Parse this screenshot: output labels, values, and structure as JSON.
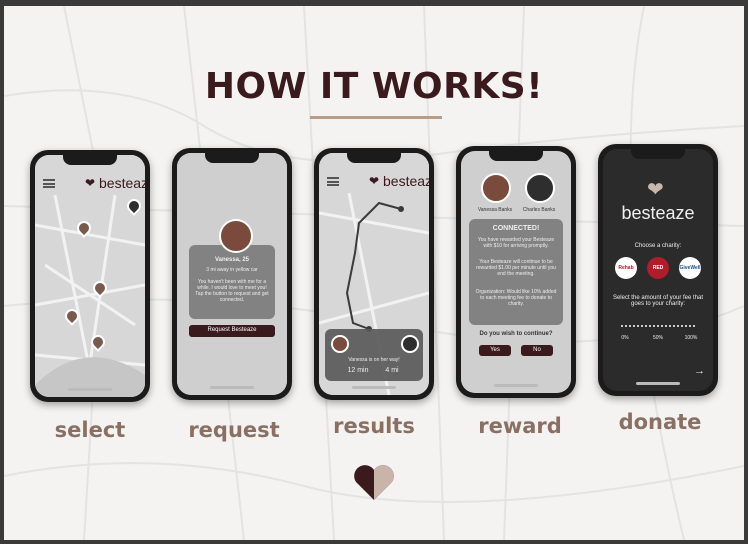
{
  "title": "HOW IT WORKS!",
  "brand": "besteaze",
  "steps": [
    {
      "label": "select"
    },
    {
      "label": "request"
    },
    {
      "label": "results"
    },
    {
      "label": "reward"
    },
    {
      "label": "donate"
    }
  ],
  "request_screen": {
    "profile_name": "Vanessa, 25",
    "profile_sub": "3 mi away in yellow car",
    "body_text": "You haven't been with me for a while. I would love to meet you! Tap the button to request and get connected.",
    "button": "Request Besteaze"
  },
  "results_screen": {
    "status": "Vanessa is on her way!",
    "time": "12 min",
    "distance": "4 mi"
  },
  "reward_screen": {
    "name_a": "Vanessa Banks",
    "name_b": "Charles Banks",
    "heading": "CONNECTED!",
    "line1": "You have rewarded your Besteaze with $10 for arriving promptly.",
    "line2": "Your Besteaze will continue to be rewarded $1.00 per minute until you end the meeting.",
    "line3": "Organization: Would like 10% added to each meeting fee to donate to charity.",
    "question": "Do you wish to continue?",
    "yes": "Yes",
    "no": "No"
  },
  "donate_screen": {
    "brand": "besteaze",
    "choose": "Choose a charity:",
    "charities": [
      "Rehab",
      "RED",
      "GiveWell"
    ],
    "select_line": "Select the amount of your fee that goes to your charity:",
    "pct": [
      "0%",
      "50%",
      "100%"
    ],
    "next_arrow": "→"
  },
  "colors": {
    "brand_dark": "#3b1a1e",
    "label_brown": "#8a6f63",
    "underline": "#b89c86"
  }
}
